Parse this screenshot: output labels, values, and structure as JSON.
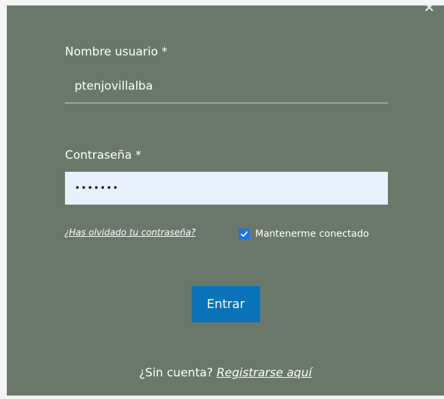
{
  "form": {
    "close_icon": "×",
    "username_label": "Nombre usuario *",
    "username_value": "ptenjovillalba",
    "password_label": "Contraseña *",
    "password_value": "•••••••",
    "forgot_password_link": "¿Has olvidado tu contraseña?",
    "remember_me_checked": true,
    "remember_me_label": "Mantenerme conectado",
    "submit_label": "Entrar",
    "signup_prompt": "¿Sin cuenta?",
    "signup_link": "Registrarse aquí"
  },
  "colors": {
    "modal_background": "#6a786c",
    "input_background": "#e8f0fe",
    "primary_button": "#0a73b8",
    "checkbox_accent": "#1a73e8"
  }
}
